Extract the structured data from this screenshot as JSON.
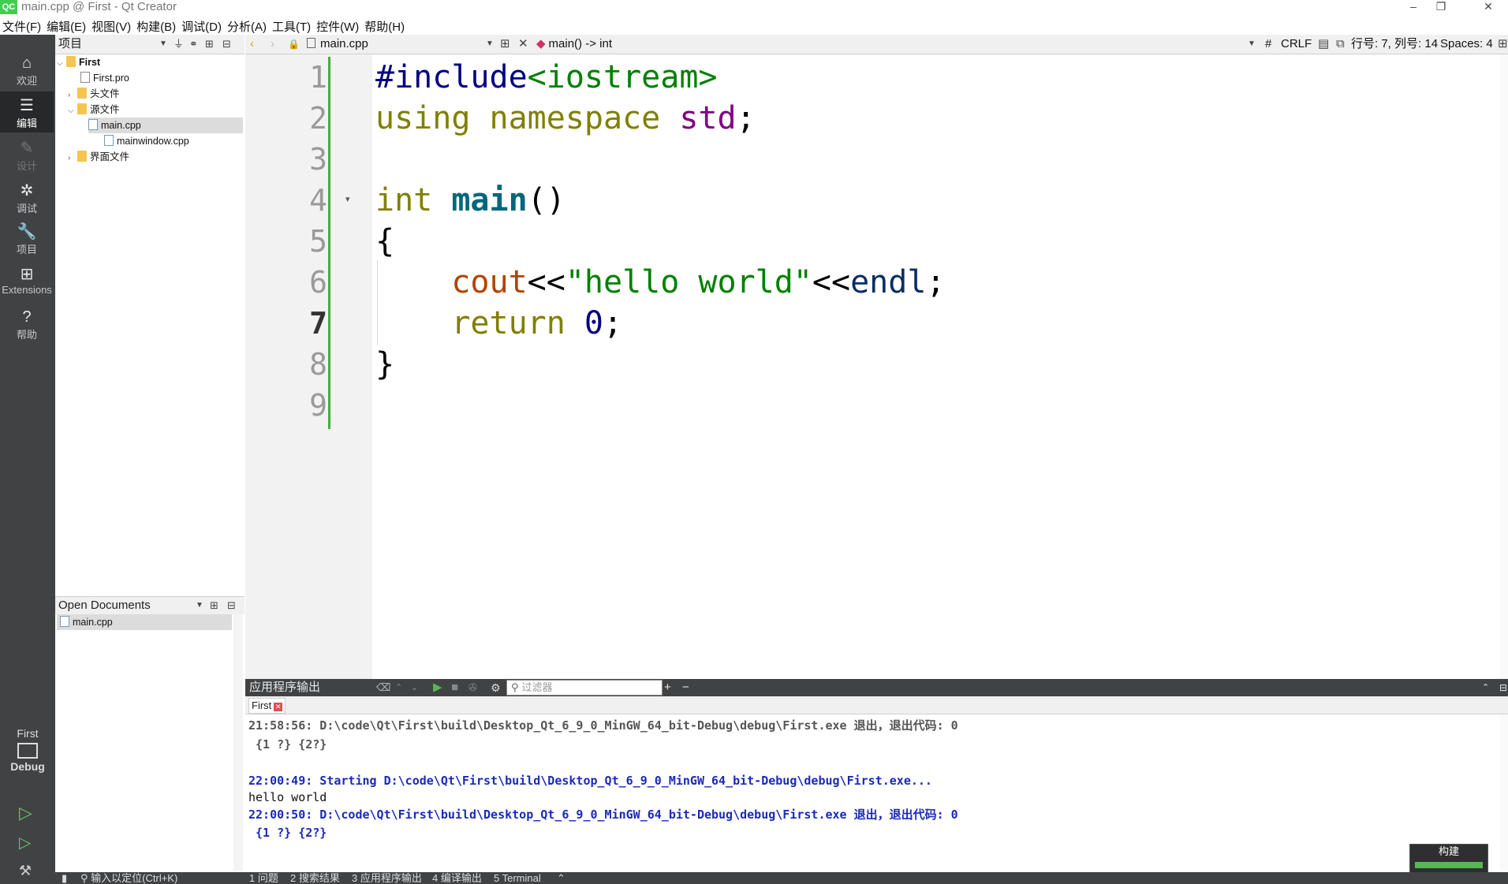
{
  "window": {
    "logo": "QC",
    "title": "main.cpp @ First - Qt Creator",
    "minimize": "–",
    "restore": "❐",
    "close": "✕"
  },
  "menubar": [
    "文件(F)",
    "编辑(E)",
    "视图(V)",
    "构建(B)",
    "调试(D)",
    "分析(A)",
    "工具(T)",
    "控件(W)",
    "帮助(H)"
  ],
  "modes": [
    {
      "label": "欢迎",
      "icon": "home-icon",
      "glyph": "⌂"
    },
    {
      "label": "编辑",
      "icon": "edit-icon",
      "glyph": "☰"
    },
    {
      "label": "设计",
      "icon": "design-icon",
      "glyph": "✎"
    },
    {
      "label": "调试",
      "icon": "debug-icon",
      "glyph": "✲"
    },
    {
      "label": "项目",
      "icon": "wrench-icon",
      "glyph": "🔧"
    },
    {
      "label": "Extensions",
      "icon": "extensions-icon",
      "glyph": "⊞"
    },
    {
      "label": "帮助",
      "icon": "help-icon",
      "glyph": "?"
    }
  ],
  "kit": {
    "project": "First",
    "config": "Debug"
  },
  "project_pane": {
    "title": "项目",
    "tree": [
      {
        "label": "First",
        "type": "project-root"
      },
      {
        "label": "First.pro",
        "type": "pro-file"
      },
      {
        "label": "头文件",
        "type": "folder"
      },
      {
        "label": "源文件",
        "type": "folder"
      },
      {
        "label": "main.cpp",
        "type": "file"
      },
      {
        "label": "mainwindow.cpp",
        "type": "file"
      },
      {
        "label": "界面文件",
        "type": "folder"
      }
    ]
  },
  "open_documents": {
    "title": "Open Documents",
    "items": [
      "main.cpp"
    ]
  },
  "editor_toolbar": {
    "file": "main.cpp",
    "symbol": "main() -> int",
    "hash": "#",
    "line_ending": "CRLF",
    "position": "行号: 7, 列号: 14",
    "indent": "Spaces: 4"
  },
  "editor": {
    "line_numbers": [
      "1",
      "2",
      "3",
      "4",
      "5",
      "6",
      "7",
      "8",
      "9"
    ],
    "current_line": 7,
    "lines": [
      [
        {
          "t": "#include",
          "c": "pp"
        },
        {
          "t": "<iostream>",
          "c": "inc"
        }
      ],
      [
        {
          "t": "using",
          "c": "kw"
        },
        {
          "t": " ",
          "c": ""
        },
        {
          "t": "namespace",
          "c": "kw"
        },
        {
          "t": " ",
          "c": ""
        },
        {
          "t": "std",
          "c": "ns"
        },
        {
          "t": ";",
          "c": ""
        }
      ],
      [],
      [
        {
          "t": "int",
          "c": "kw"
        },
        {
          "t": " ",
          "c": ""
        },
        {
          "t": "main",
          "c": "fn"
        },
        {
          "t": "()",
          "c": ""
        }
      ],
      [
        {
          "t": "{",
          "c": ""
        }
      ],
      [
        {
          "t": "    ",
          "c": ""
        },
        {
          "t": "cout",
          "c": "var"
        },
        {
          "t": "<<",
          "c": ""
        },
        {
          "t": "\"hello world\"",
          "c": "str"
        },
        {
          "t": "<<",
          "c": ""
        },
        {
          "t": "endl",
          "c": "ctl"
        },
        {
          "t": ";",
          "c": ""
        }
      ],
      [
        {
          "t": "    ",
          "c": ""
        },
        {
          "t": "return",
          "c": "kw"
        },
        {
          "t": " ",
          "c": ""
        },
        {
          "t": "0",
          "c": "num"
        },
        {
          "t": ";",
          "c": ""
        }
      ],
      [
        {
          "t": "}",
          "c": ""
        }
      ],
      []
    ]
  },
  "output": {
    "title": "应用程序输出",
    "filter_placeholder": "过滤器",
    "add": "+",
    "remove": "−",
    "tab": "First",
    "lines": [
      {
        "text": "21:58:56: D:\\code\\Qt\\First\\build\\Desktop_Qt_6_9_0_MinGW_64_bit-Debug\\debug\\First.exe 退出，退出代码: 0",
        "style": "grey"
      },
      {
        "text": " {1 ?} {2?}",
        "style": "grey"
      },
      {
        "text": "",
        "style": "plain"
      },
      {
        "text": "22:00:49: Starting D:\\code\\Qt\\First\\build\\Desktop_Qt_6_9_0_MinGW_64_bit-Debug\\debug\\First.exe...",
        "style": "blue"
      },
      {
        "text": "hello world",
        "style": "plain"
      },
      {
        "text": "22:00:50: D:\\code\\Qt\\First\\build\\Desktop_Qt_6_9_0_MinGW_64_bit-Debug\\debug\\First.exe 退出，退出代码: 0",
        "style": "blue"
      },
      {
        "text": " {1 ?} {2?}",
        "style": "blue"
      }
    ]
  },
  "statusbar": {
    "locator_placeholder": "输入以定位(Ctrl+K)",
    "tabs": [
      "1 问题",
      "2 搜索结果",
      "3 应用程序输出",
      "4 编译输出",
      "5 Terminal"
    ]
  },
  "build": {
    "label": "构建",
    "progress": 1.0
  }
}
